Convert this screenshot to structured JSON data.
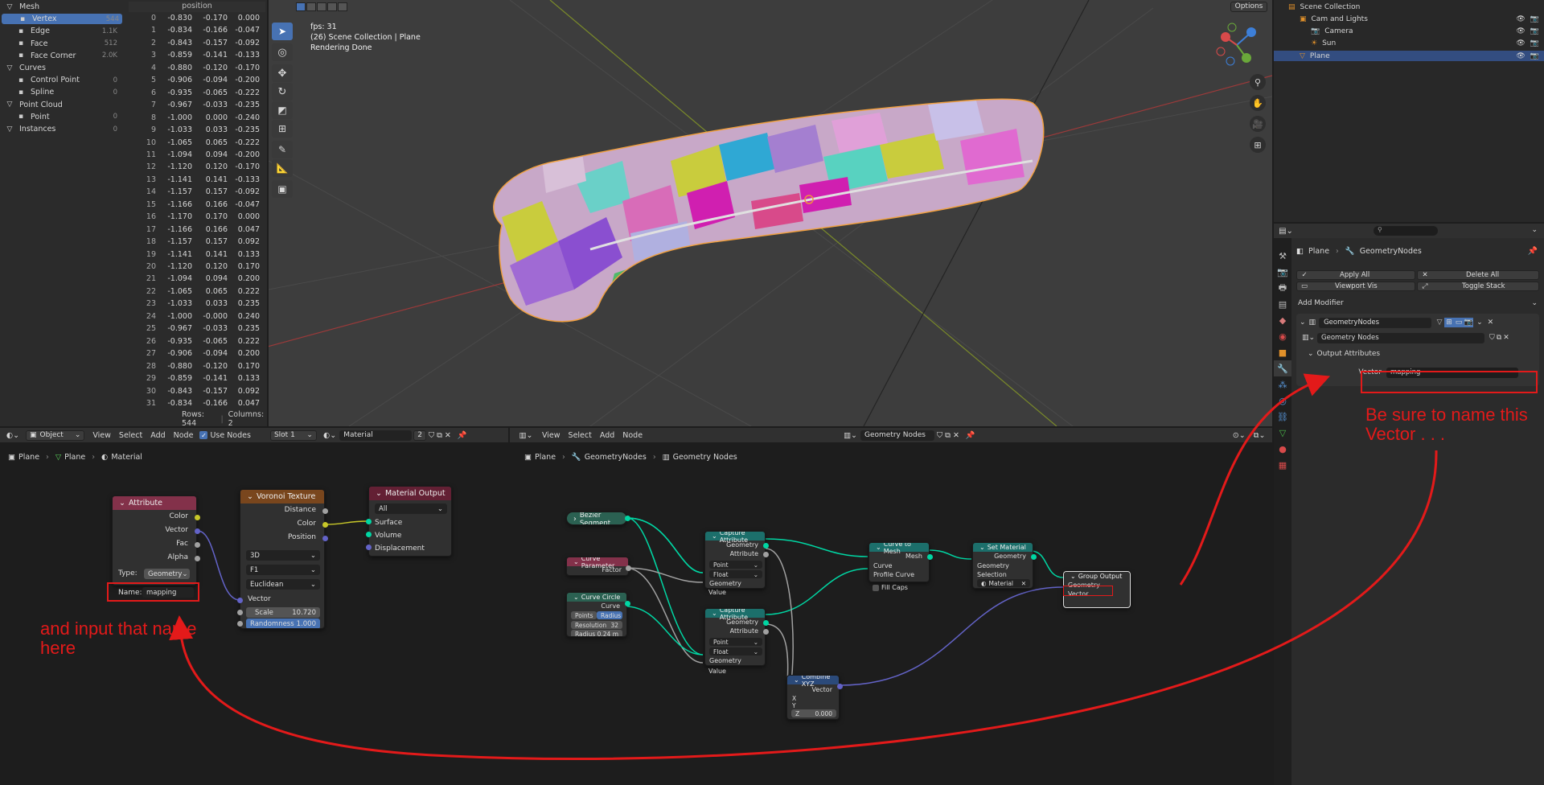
{
  "colors": {
    "accent_blue": "#4772b3",
    "annotation_red": "#e31a1a",
    "node_attribute_header": "#83314a",
    "node_texture_header": "#79461d",
    "node_output_header": "#632034",
    "node_geometry_header": "#1c6f6b",
    "node_curve_header": "#2b6152",
    "socket_geometry": "#00d6a3",
    "socket_vector": "#6363c7",
    "socket_float": "#a1a1a1",
    "socket_color": "#c7c729"
  },
  "spreadsheet": {
    "column_header": "position",
    "tree": [
      {
        "label": "Mesh",
        "count": "",
        "icon": "mesh-icon",
        "indent": 0,
        "active": false
      },
      {
        "label": "Vertex",
        "count": "544",
        "icon": "vertex-icon",
        "indent": 1,
        "active": true
      },
      {
        "label": "Edge",
        "count": "1.1K",
        "icon": "edge-icon",
        "indent": 1,
        "active": false
      },
      {
        "label": "Face",
        "count": "512",
        "icon": "face-icon",
        "indent": 1,
        "active": false
      },
      {
        "label": "Face Corner",
        "count": "2.0K",
        "icon": "face-corner-icon",
        "indent": 1,
        "active": false
      },
      {
        "label": "Curves",
        "count": "",
        "icon": "curves-icon",
        "indent": 0,
        "active": false
      },
      {
        "label": "Control Point",
        "count": "0",
        "icon": "control-point-icon",
        "indent": 1,
        "active": false
      },
      {
        "label": "Spline",
        "count": "0",
        "icon": "spline-icon",
        "indent": 1,
        "active": false
      },
      {
        "label": "Point Cloud",
        "count": "",
        "icon": "point-cloud-icon",
        "indent": 0,
        "active": false
      },
      {
        "label": "Point",
        "count": "0",
        "icon": "point-icon",
        "indent": 1,
        "active": false
      },
      {
        "label": "Instances",
        "count": "0",
        "icon": "instances-icon",
        "indent": 0,
        "active": false
      }
    ],
    "rows": [
      [
        "0",
        "-0.830",
        "-0.170",
        "0.000"
      ],
      [
        "1",
        "-0.834",
        "-0.166",
        "-0.047"
      ],
      [
        "2",
        "-0.843",
        "-0.157",
        "-0.092"
      ],
      [
        "3",
        "-0.859",
        "-0.141",
        "-0.133"
      ],
      [
        "4",
        "-0.880",
        "-0.120",
        "-0.170"
      ],
      [
        "5",
        "-0.906",
        "-0.094",
        "-0.200"
      ],
      [
        "6",
        "-0.935",
        "-0.065",
        "-0.222"
      ],
      [
        "7",
        "-0.967",
        "-0.033",
        "-0.235"
      ],
      [
        "8",
        "-1.000",
        "0.000",
        "-0.240"
      ],
      [
        "9",
        "-1.033",
        "0.033",
        "-0.235"
      ],
      [
        "10",
        "-1.065",
        "0.065",
        "-0.222"
      ],
      [
        "11",
        "-1.094",
        "0.094",
        "-0.200"
      ],
      [
        "12",
        "-1.120",
        "0.120",
        "-0.170"
      ],
      [
        "13",
        "-1.141",
        "0.141",
        "-0.133"
      ],
      [
        "14",
        "-1.157",
        "0.157",
        "-0.092"
      ],
      [
        "15",
        "-1.166",
        "0.166",
        "-0.047"
      ],
      [
        "16",
        "-1.170",
        "0.170",
        "0.000"
      ],
      [
        "17",
        "-1.166",
        "0.166",
        "0.047"
      ],
      [
        "18",
        "-1.157",
        "0.157",
        "0.092"
      ],
      [
        "19",
        "-1.141",
        "0.141",
        "0.133"
      ],
      [
        "20",
        "-1.120",
        "0.120",
        "0.170"
      ],
      [
        "21",
        "-1.094",
        "0.094",
        "0.200"
      ],
      [
        "22",
        "-1.065",
        "0.065",
        "0.222"
      ],
      [
        "23",
        "-1.033",
        "0.033",
        "0.235"
      ],
      [
        "24",
        "-1.000",
        "-0.000",
        "0.240"
      ],
      [
        "25",
        "-0.967",
        "-0.033",
        "0.235"
      ],
      [
        "26",
        "-0.935",
        "-0.065",
        "0.222"
      ],
      [
        "27",
        "-0.906",
        "-0.094",
        "0.200"
      ],
      [
        "28",
        "-0.880",
        "-0.120",
        "0.170"
      ],
      [
        "29",
        "-0.859",
        "-0.141",
        "0.133"
      ],
      [
        "30",
        "-0.843",
        "-0.157",
        "0.092"
      ],
      [
        "31",
        "-0.834",
        "-0.166",
        "0.047"
      ]
    ],
    "footer": {
      "rows": "Rows: 544",
      "columns": "Columns: 2"
    }
  },
  "viewport": {
    "fps": "fps: 31",
    "collection": "(26) Scene Collection | Plane",
    "status": "Rendering Done",
    "options_label": "Options",
    "gizmo_axes": [
      "X",
      "Y",
      "Z"
    ]
  },
  "outliner": {
    "items": [
      {
        "label": "Scene Collection",
        "indent": 0,
        "selected": false
      },
      {
        "label": "Cam and Lights",
        "indent": 1,
        "selected": false
      },
      {
        "label": "Camera",
        "indent": 2,
        "selected": false
      },
      {
        "label": "Sun",
        "indent": 2,
        "selected": false
      },
      {
        "label": "Plane",
        "indent": 1,
        "selected": true
      }
    ]
  },
  "properties": {
    "breadcrumb": {
      "object": "Plane",
      "modifier": "GeometryNodes"
    },
    "apply_all": "Apply All",
    "delete_all": "Delete All",
    "viewport_vis": "Viewport Vis",
    "toggle_stack": "Toggle Stack",
    "add_modifier": "Add Modifier",
    "modifier_name": "GeometryNodes",
    "node_group": "Geometry Nodes",
    "output_attributes": "Output Attributes",
    "vector_label": "Vector",
    "vector_value": "mapping"
  },
  "shader_editor": {
    "header": {
      "view": "View",
      "select": "Select",
      "add": "Add",
      "node": "Node",
      "use_nodes": "Use Nodes",
      "editor_mode": "Object",
      "slot": "Slot 1",
      "material": "Material",
      "users": "2"
    },
    "breadcrumb": [
      "Plane",
      "Plane",
      "Material"
    ],
    "nodes": {
      "attribute": {
        "title": "Attribute",
        "outputs": [
          "Color",
          "Vector",
          "Fac",
          "Alpha"
        ],
        "type_label": "Type:",
        "type_value": "Geometry",
        "name_label": "Name:",
        "name_value": "mapping"
      },
      "voronoi": {
        "title": "Voronoi Texture",
        "outputs": [
          "Distance",
          "Color",
          "Position"
        ],
        "dims": "3D",
        "feature": "F1",
        "metric": "Euclidean",
        "vector": "Vector",
        "scale_label": "Scale",
        "scale_value": "10.720",
        "random_label": "Randomness",
        "random_value": "1.000"
      },
      "material_output": {
        "title": "Material Output",
        "target": "All",
        "inputs": [
          "Surface",
          "Volume",
          "Displacement"
        ]
      }
    }
  },
  "geo_editor": {
    "header": {
      "view": "View",
      "select": "Select",
      "add": "Add",
      "node": "Node",
      "tree": "Geometry Nodes"
    },
    "breadcrumb": [
      "Plane",
      "GeometryNodes",
      "Geometry Nodes"
    ],
    "nodes": {
      "bezier": {
        "title": "Bezier Segment"
      },
      "curve_param": {
        "title": "Curve Parameter",
        "output": "Factor"
      },
      "curve_circle": {
        "title": "Curve Circle",
        "output": "Curve",
        "mode_a": "Points",
        "mode_b": "Radius",
        "res_label": "Resolution",
        "res_value": "32",
        "rad_label": "Radius",
        "rad_value": "0.24 m"
      },
      "capture1": {
        "title": "Capture Attribute",
        "outputs": [
          "Geometry",
          "Attribute"
        ],
        "domain": "Point",
        "type": "Float",
        "inputs": [
          "Geometry",
          "Value"
        ]
      },
      "capture2": {
        "title": "Capture Attribute",
        "outputs": [
          "Geometry",
          "Attribute"
        ],
        "domain": "Point",
        "type": "Float",
        "inputs": [
          "Geometry",
          "Value"
        ]
      },
      "curve_to_mesh": {
        "title": "Curve to Mesh",
        "output": "Mesh",
        "inputs": [
          "Curve",
          "Profile Curve",
          "Fill Caps"
        ]
      },
      "set_material": {
        "title": "Set Material",
        "output": "Geometry",
        "inputs": [
          "Geometry",
          "Selection",
          "Material"
        ]
      },
      "group_output": {
        "title": "Group Output",
        "inputs": [
          "Geometry",
          "Vector"
        ]
      },
      "combine_xyz": {
        "title": "Combine XYZ",
        "output": "Vector",
        "inputs": [
          "X",
          "Y",
          "Z"
        ],
        "z_value": "0.000"
      }
    }
  },
  "annotations": {
    "right_note": "Be sure to name this Vector . . .",
    "left_note": "and input that name here"
  }
}
